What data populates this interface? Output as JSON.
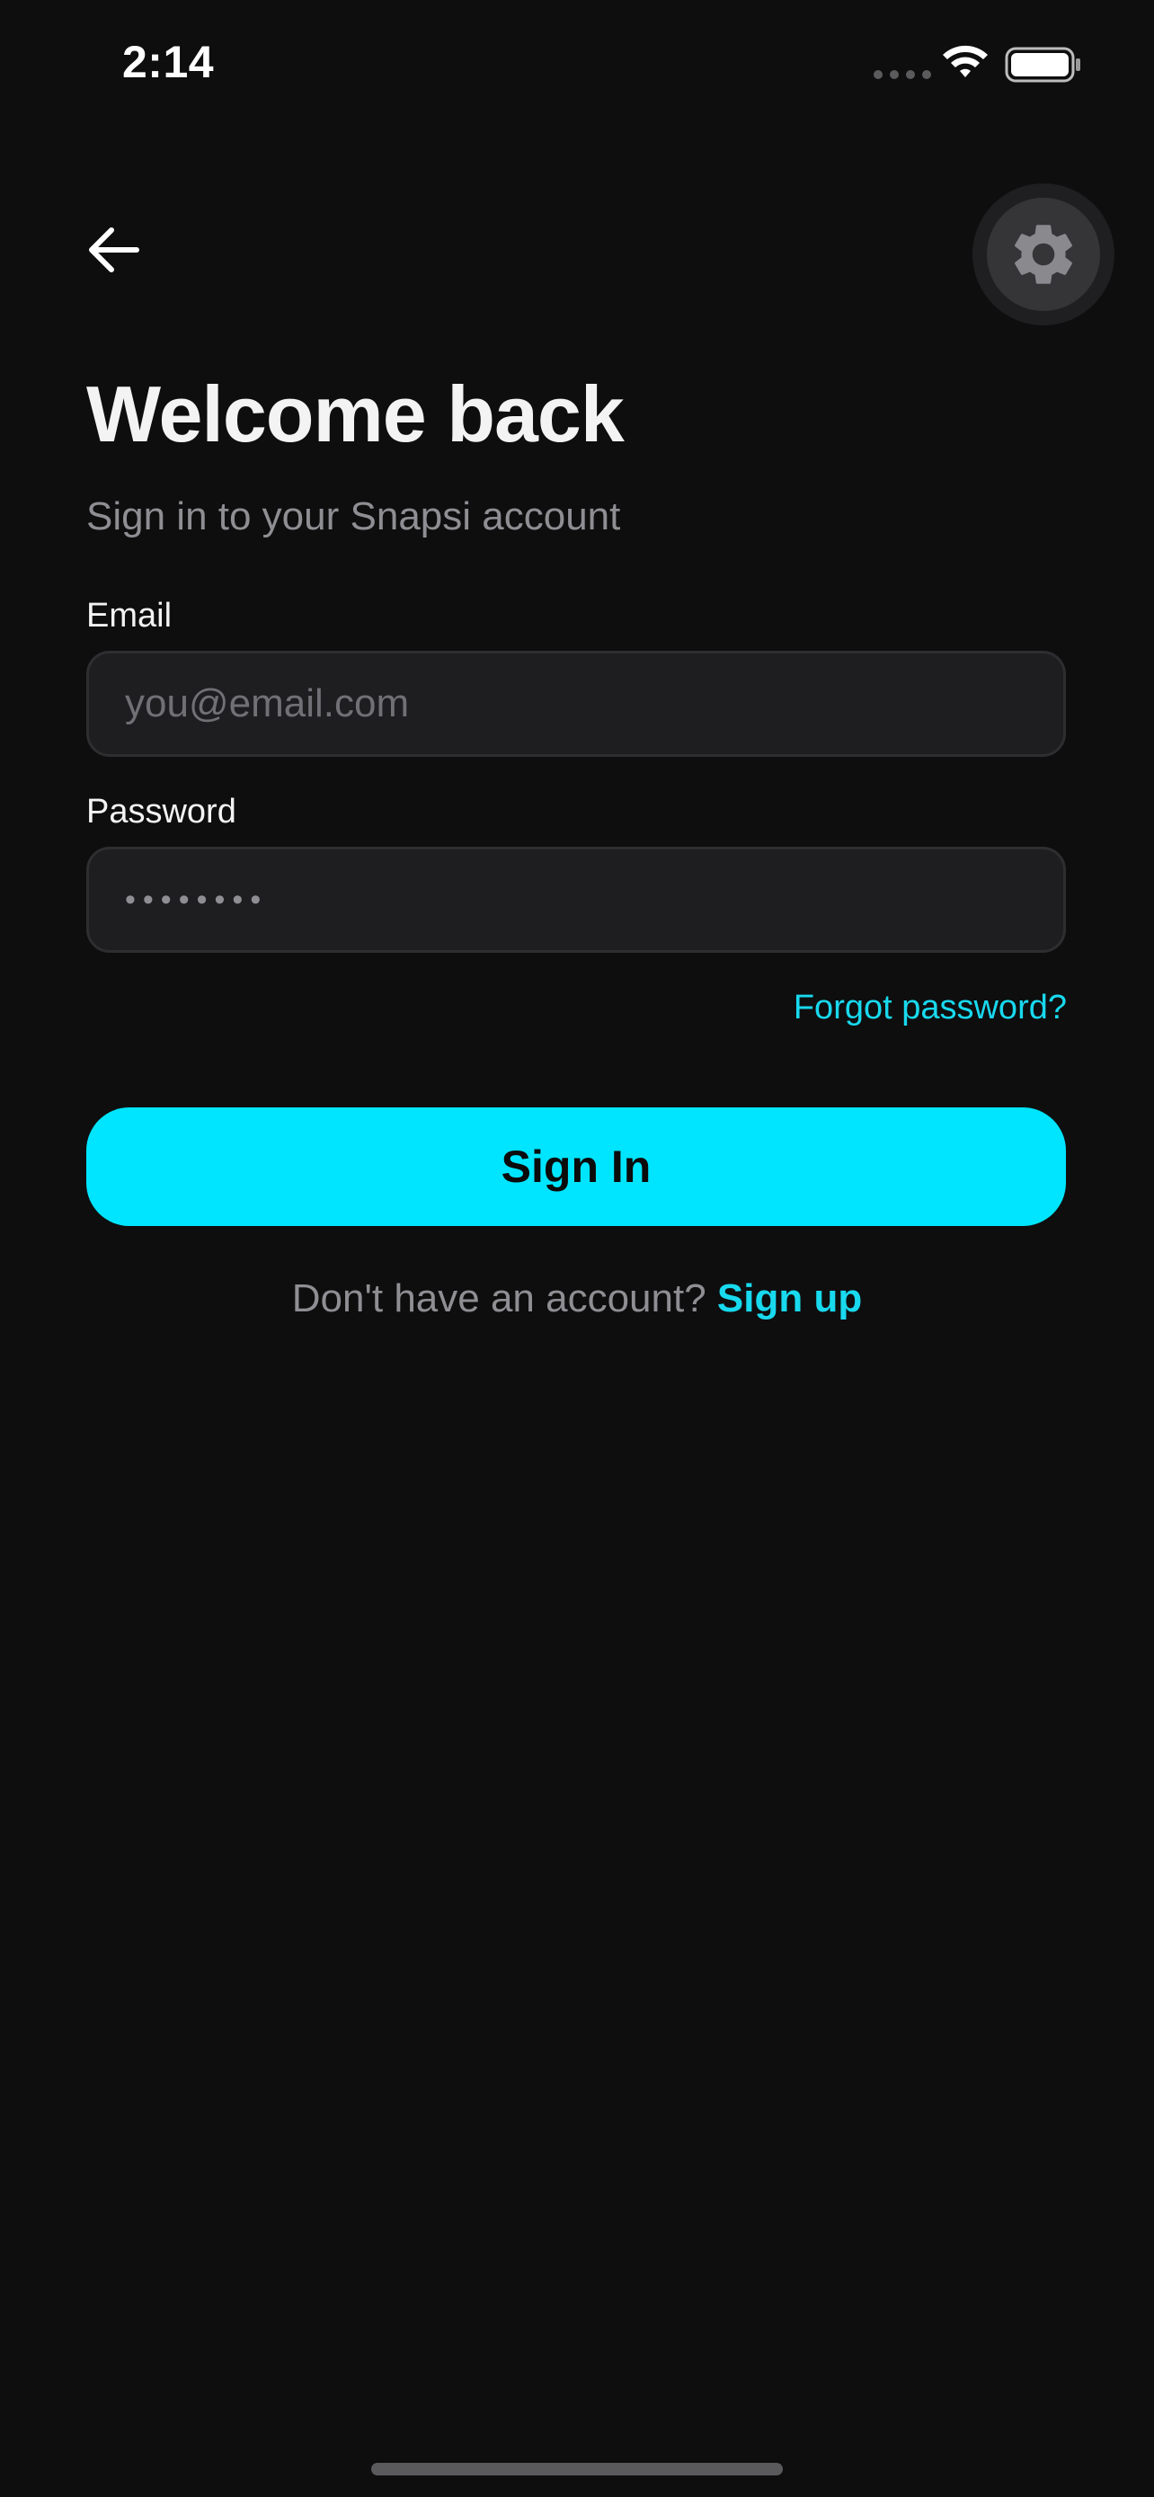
{
  "status_bar": {
    "time": "2:14"
  },
  "icons": {
    "back": "arrow-left-icon",
    "settings": "gear-icon",
    "wifi": "wifi-icon",
    "battery": "battery-icon",
    "signal": "cellular-signal-icon"
  },
  "header": {
    "title": "Welcome back",
    "subtitle": "Sign in to your Snapsi account"
  },
  "form": {
    "email_label": "Email",
    "email_placeholder": "you@email.com",
    "email_value": "",
    "password_label": "Password",
    "password_value": "••••••••",
    "forgot_link": "Forgot password?",
    "submit_label": "Sign In"
  },
  "footer": {
    "prompt": "Don't have an account?",
    "signup_link": "Sign up"
  },
  "colors": {
    "background": "#0e0e0f",
    "accent": "#00e5ff",
    "link": "#18d9ee",
    "input_bg": "#1e1e20",
    "muted_text": "#8e8e93"
  }
}
